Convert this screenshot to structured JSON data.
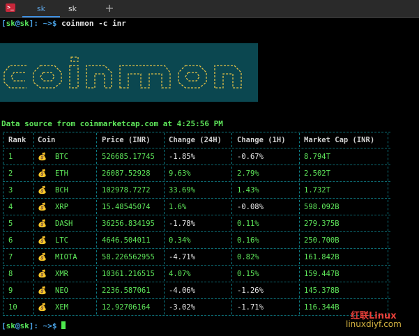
{
  "window": {
    "terminal_icon_glyph": ">_",
    "tabs": [
      {
        "label": "sk",
        "active": true
      },
      {
        "label": "sk",
        "active": false
      }
    ],
    "new_tab_glyph": "+"
  },
  "prompt": {
    "open": "[",
    "user": "sk",
    "at": "@",
    "host": "sk",
    "close_path": "]: ~>$ ",
    "command": "coinmon -c inr"
  },
  "banner": {
    "text": "coinmon",
    "bg_color": "#0b4750",
    "fg_color": "#e3c147"
  },
  "source_line": "Data source from coinmarketcap.com at 4:25:56 PM",
  "table": {
    "headers": [
      "Rank",
      "Coin",
      "Price (INR)",
      "Change (24H)",
      "Change (1H)",
      "Market Cap (INR)"
    ],
    "coin_icon": "💰",
    "rows": [
      {
        "rank": "1",
        "coin": "BTC",
        "price": "526685.17745",
        "c24": "-1.85%",
        "c1": "-0.67%",
        "cap": "8.794T"
      },
      {
        "rank": "2",
        "coin": "ETH",
        "price": "26087.52928",
        "c24": "9.63%",
        "c1": "2.79%",
        "cap": "2.502T"
      },
      {
        "rank": "3",
        "coin": "BCH",
        "price": "102978.7272",
        "c24": "33.69%",
        "c1": "1.43%",
        "cap": "1.732T"
      },
      {
        "rank": "4",
        "coin": "XRP",
        "price": "15.48545074",
        "c24": "1.6%",
        "c1": "-0.08%",
        "cap": "598.092B"
      },
      {
        "rank": "5",
        "coin": "DASH",
        "price": "36256.834195",
        "c24": "-1.78%",
        "c1": "0.11%",
        "cap": "279.375B"
      },
      {
        "rank": "6",
        "coin": "LTC",
        "price": "4646.504011",
        "c24": "0.34%",
        "c1": "0.16%",
        "cap": "250.700B"
      },
      {
        "rank": "7",
        "coin": "MIOTA",
        "price": "58.226562955",
        "c24": "-4.71%",
        "c1": "0.82%",
        "cap": "161.842B"
      },
      {
        "rank": "8",
        "coin": "XMR",
        "price": "10361.216515",
        "c24": "4.07%",
        "c1": "0.15%",
        "cap": "159.447B"
      },
      {
        "rank": "9",
        "coin": "NEO",
        "price": "2236.587061",
        "c24": "-4.06%",
        "c1": "-1.26%",
        "cap": "145.378B"
      },
      {
        "rank": "10",
        "coin": "XEM",
        "price": "12.92706164",
        "c24": "-3.02%",
        "c1": "-1.71%",
        "cap": "116.344B"
      }
    ]
  },
  "watermark": {
    "line1": "红联Linux",
    "line2": "linuxdiyf.com"
  },
  "colors": {
    "green": "#5ee65a",
    "blue": "#4aa3e6",
    "teal_border": "#0c7a83",
    "background": "#000000"
  }
}
